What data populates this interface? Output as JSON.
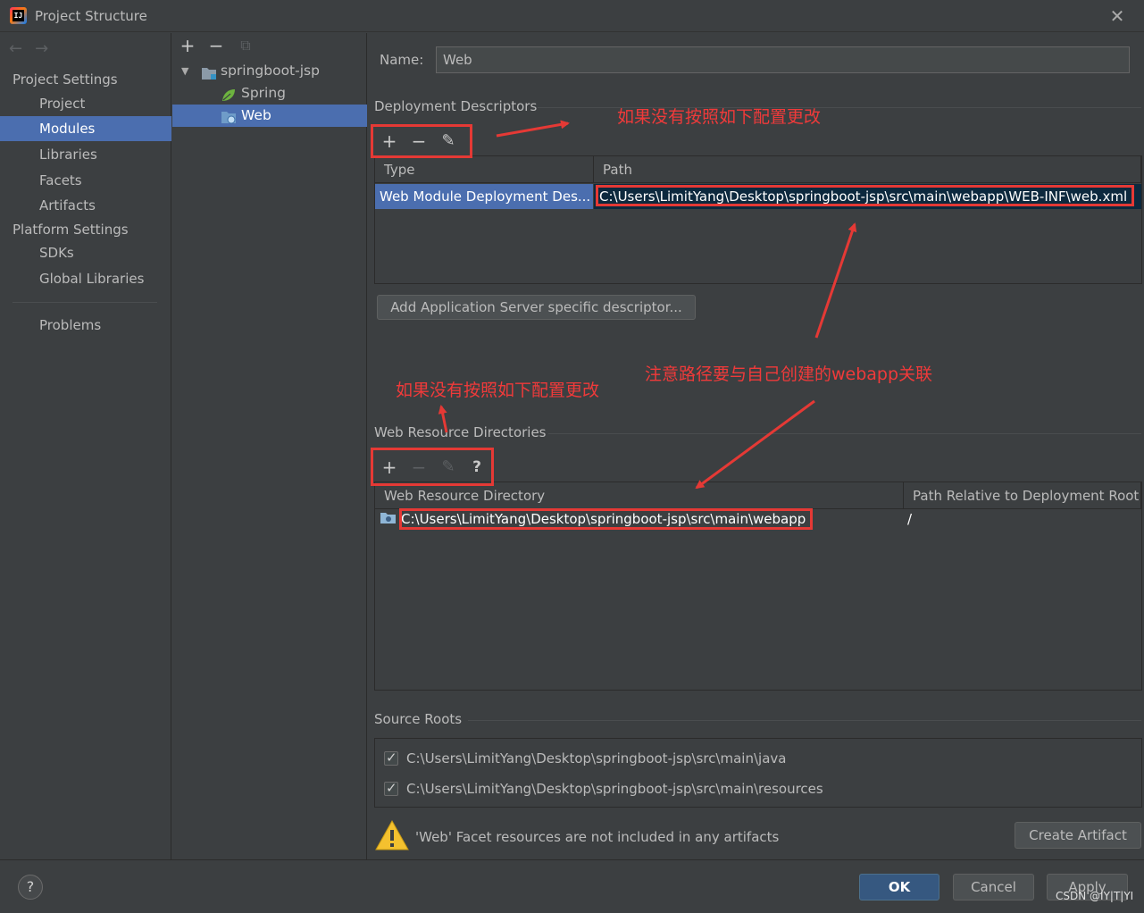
{
  "window": {
    "title": "Project Structure",
    "close": "✕"
  },
  "nav": {
    "back": "←",
    "forward": "→"
  },
  "categories": {
    "project_settings_header": "Project Settings",
    "project_settings": [
      "Project",
      "Modules",
      "Libraries",
      "Facets",
      "Artifacts"
    ],
    "selected": "Modules",
    "platform_settings_header": "Platform Settings",
    "platform_settings": [
      "SDKs",
      "Global Libraries"
    ],
    "problems": "Problems"
  },
  "tree": {
    "toolbar": {
      "add": "+",
      "remove": "−",
      "copy": "⧉"
    },
    "root": "springboot-jsp",
    "children": [
      "Spring",
      "Web"
    ],
    "selected": "Web"
  },
  "facet": {
    "name_label": "Name:",
    "name_value": "Web",
    "deployment_descriptors": {
      "title": "Deployment Descriptors",
      "toolbar": {
        "add": "+",
        "remove": "−",
        "edit": "✎"
      },
      "columns": [
        "Type",
        "Path"
      ],
      "rows": [
        {
          "type": "Web Module Deployment Des...",
          "path": "C:\\Users\\LimitYang\\Desktop\\springboot-jsp\\src\\main\\webapp\\WEB-INF\\web.xml"
        }
      ],
      "add_server_button": "Add Application Server specific descriptor..."
    },
    "web_resource_directories": {
      "title": "Web Resource Directories",
      "toolbar": {
        "add": "+",
        "remove": "−",
        "edit": "✎",
        "help": "?"
      },
      "columns": [
        "Web Resource Directory",
        "Path Relative to Deployment Root"
      ],
      "rows": [
        {
          "directory": "C:\\Users\\LimitYang\\Desktop\\springboot-jsp\\src\\main\\webapp",
          "relative": "/"
        }
      ]
    },
    "source_roots": {
      "title": "Source Roots",
      "items": [
        {
          "path": "C:\\Users\\LimitYang\\Desktop\\springboot-jsp\\src\\main\\java",
          "checked": true
        },
        {
          "path": "C:\\Users\\LimitYang\\Desktop\\springboot-jsp\\src\\main\\resources",
          "checked": true
        }
      ]
    },
    "warning": {
      "text": "'Web' Facet resources are not included in any artifacts",
      "button": "Create Artifact"
    }
  },
  "footer": {
    "help": "?",
    "ok": "OK",
    "cancel": "Cancel",
    "apply": "Apply"
  },
  "annotations": {
    "note_top": "如果没有按照如下配置更改",
    "note_path": "注意路径要与自己创建的webapp关联",
    "note_middle": "如果没有按照如下配置更改",
    "color": "#f03a3a"
  },
  "watermark": "CSDN @IY|T|YI",
  "colors": {
    "background": "#3c3f41",
    "selection": "#4b6eaf",
    "ok_button": "#365880",
    "annotation": "#e53935"
  }
}
